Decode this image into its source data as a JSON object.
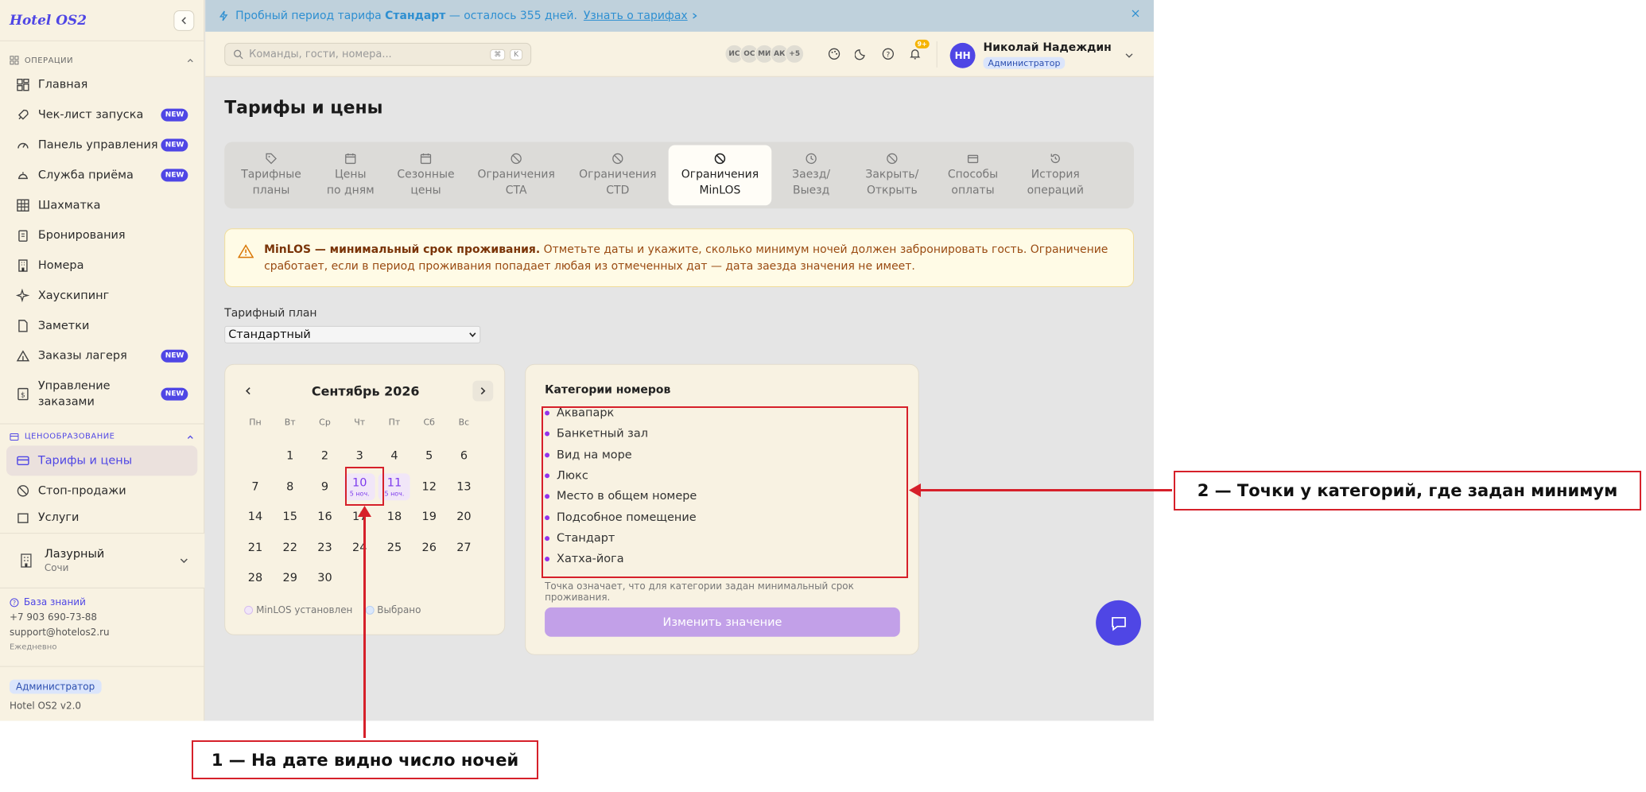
{
  "app": {
    "logo": "Hotel OS2",
    "version": "Hotel OS2 v2.0"
  },
  "sidebar": {
    "sections": [
      {
        "title": "ОПЕРАЦИИ"
      },
      {
        "title": "ЦЕНООБРАЗОВАНИЕ"
      }
    ],
    "items": [
      {
        "label": "Главная",
        "icon": "grid-icon",
        "badge": ""
      },
      {
        "label": "Чек-лист запуска",
        "icon": "rocket-icon",
        "badge": "NEW"
      },
      {
        "label": "Панель управления",
        "icon": "gauge-icon",
        "badge": "NEW"
      },
      {
        "label": "Служба приёма",
        "icon": "bell-icon",
        "badge": "NEW"
      },
      {
        "label": "Шахматка",
        "icon": "table-icon",
        "badge": ""
      },
      {
        "label": "Бронирования",
        "icon": "clipboard-icon",
        "badge": ""
      },
      {
        "label": "Номера",
        "icon": "building-icon",
        "badge": ""
      },
      {
        "label": "Хаускипинг",
        "icon": "sparkle-icon",
        "badge": ""
      },
      {
        "label": "Заметки",
        "icon": "file-icon",
        "badge": ""
      },
      {
        "label": "Заказы лагеря",
        "icon": "tent-icon",
        "badge": "NEW"
      },
      {
        "label": "Управление заказами",
        "icon": "dollar-icon",
        "badge": "NEW"
      }
    ],
    "pricing_items": [
      {
        "label": "Тарифы и цены",
        "icon": "card-icon",
        "active": true
      },
      {
        "label": "Стоп-продажи",
        "icon": "ban-icon",
        "active": false
      },
      {
        "label": "Услуги",
        "icon": "box-icon",
        "active": false
      }
    ],
    "hotel": {
      "name": "Лазурный",
      "city": "Сочи"
    },
    "support": {
      "kb_label": "База знаний",
      "phone": "+7 903 690-73-88",
      "email": "support@hotelos2.ru",
      "hours": "Ежедневно"
    },
    "role": "Администратор"
  },
  "banner": {
    "prefix": "Пробный период тарифа",
    "plan": "Стандарт",
    "suffix": "— осталось 355 дней.",
    "link": "Узнать о тарифах"
  },
  "topbar": {
    "search_placeholder": "Команды, гости, номера...",
    "kbd1": "⌘",
    "kbd2": "K",
    "avatars": [
      "ИС",
      "ОС",
      "МИ",
      "АК",
      "+5"
    ],
    "notif_count": "9+",
    "user": {
      "initials": "НН",
      "name": "Николай Надеждин",
      "role": "Администратор"
    }
  },
  "page": {
    "title": "Тарифы и цены",
    "tabs": [
      {
        "l1": "Тарифные",
        "l2": "планы",
        "icon": "tag-icon",
        "active": false
      },
      {
        "l1": "Цены",
        "l2": "по дням",
        "icon": "calendar-icon",
        "active": false
      },
      {
        "l1": "Сезонные",
        "l2": "цены",
        "icon": "calendar-icon",
        "active": false
      },
      {
        "l1": "Ограничения",
        "l2": "CTA",
        "icon": "ban-icon",
        "active": false
      },
      {
        "l1": "Ограничения",
        "l2": "CTD",
        "icon": "ban-icon",
        "active": false
      },
      {
        "l1": "Ограничения",
        "l2": "MinLOS",
        "icon": "ban-icon",
        "active": true
      },
      {
        "l1": "Заезд/",
        "l2": "Выезд",
        "icon": "clock-icon",
        "active": false
      },
      {
        "l1": "Закрыть/",
        "l2": "Открыть",
        "icon": "ban-icon",
        "active": false
      },
      {
        "l1": "Способы",
        "l2": "оплаты",
        "icon": "card-icon",
        "active": false
      },
      {
        "l1": "История",
        "l2": "операций",
        "icon": "history-icon",
        "active": false
      }
    ],
    "alert": {
      "bold": "MinLOS — минимальный срок проживания.",
      "text": " Отметьте даты и укажите, сколько минимум ночей должен забронировать гость. Ограничение сработает, если в период проживания попадает любая из отмеченных дат — дата заезда значения не имеет."
    },
    "rate_plan": {
      "label": "Тарифный план",
      "value": "Стандартный"
    }
  },
  "calendar": {
    "month": "Сентябрь 2026",
    "weekdays": [
      "Пн",
      "Вт",
      "Ср",
      "Чт",
      "Пт",
      "Сб",
      "Вс"
    ],
    "lead_blanks": 1,
    "days": 30,
    "minlos": [
      {
        "day": 10,
        "nights": "5 ноч."
      },
      {
        "day": 11,
        "nights": "5 ноч."
      }
    ],
    "legend_set": "MinLOS установлен",
    "legend_selected": "Выбрано",
    "legend_set_color": "#f1e6f8",
    "legend_selected_color": "#dbe8fb"
  },
  "categories": {
    "title": "Категории номеров",
    "items": [
      "Аквапарк",
      "Банкетный зал",
      "Вид на море",
      "Люкс",
      "Место в общем номере",
      "Подсобное помещение",
      "Стандарт",
      "Хатха-йога"
    ],
    "hint": "Точка означает, что для категории задан минимальный срок проживания.",
    "button": "Изменить значение",
    "dot_color": "#9333ea"
  },
  "annotations": {
    "a1": "1 — На дате видно число ночей",
    "a2": "2 — Точки у категорий, где задан минимум"
  },
  "colors": {
    "accent": "#4f46e5",
    "annotation": "#d6202a",
    "sidebar_bg": "#f8f2e2"
  }
}
